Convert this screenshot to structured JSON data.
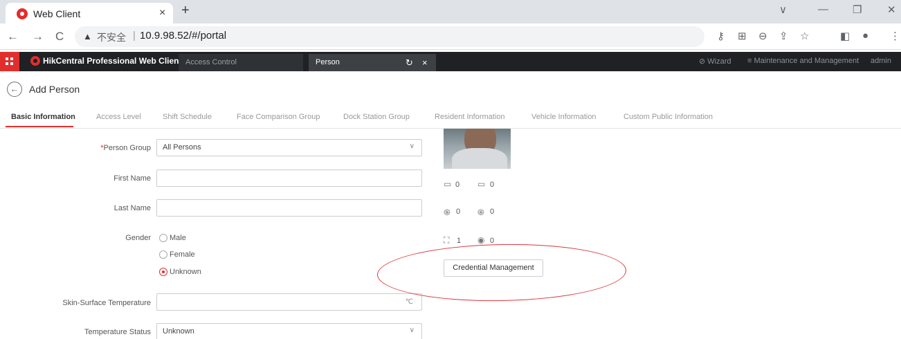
{
  "browser": {
    "tab_title": "Web Client",
    "tab_close": "×",
    "new_tab": "+",
    "window_controls": {
      "dropdown": "∨",
      "minimize": "—",
      "restore": "❐",
      "close": "✕"
    },
    "nav": {
      "back": "←",
      "forward": "→",
      "reload": "C"
    },
    "address": {
      "insecure_label": "不安全",
      "separator": "|",
      "url": "10.9.98.52/#/portal"
    },
    "toolbar_icons": {
      "key": "⚷",
      "translate": "⊞",
      "zoom": "⊖",
      "share": "⇪",
      "bookmark": "☆",
      "sidebar": "◧",
      "profile": "●",
      "menu": "⋮"
    }
  },
  "app_header": {
    "brand": "HikCentral Professional Web Client",
    "tabs": [
      "Access Control",
      "Person"
    ],
    "refresh_icon": "↻",
    "close_icon": "×",
    "wizard": "⊘ Wizard",
    "maintenance": "≡ Maintenance and Management",
    "user": "admin"
  },
  "page": {
    "back_icon": "←",
    "title": "Add Person",
    "tabs": [
      "Basic Information",
      "Access Level",
      "Shift Schedule",
      "Face Comparison Group",
      "Dock Station Group",
      "Resident Information",
      "Vehicle Information",
      "Custom Public Information"
    ],
    "active_tab": "Basic Information"
  },
  "form": {
    "person_group": {
      "required_mark": "*",
      "label": "Person Group",
      "value": "All Persons",
      "caret": "∨"
    },
    "first_name": {
      "label": "First Name",
      "value": ""
    },
    "last_name": {
      "label": "Last Name",
      "value": ""
    },
    "gender": {
      "label": "Gender",
      "options": [
        "Male",
        "Female",
        "Unknown"
      ],
      "selected": "Unknown"
    },
    "skin_temperature": {
      "label": "Skin-Surface Temperature",
      "value": "",
      "unit": "℃"
    },
    "temperature_status": {
      "label": "Temperature Status",
      "value": "Unknown",
      "caret": "∨"
    }
  },
  "credentials": {
    "counts": {
      "card": "0",
      "card_reader": "0",
      "fingerprint": "0",
      "fingerprint_reader": "0",
      "face": "1",
      "iris": "0"
    },
    "icons": {
      "card": "▭",
      "card_reader": "▭",
      "fingerprint": "֍",
      "fingerprint_reader": "֍",
      "face": "⛶",
      "iris": "◉"
    },
    "button_label": "Credential Management"
  },
  "colors": {
    "accent": "#e22d2d",
    "header_bg": "#1f2124",
    "annotation": "#d9363e"
  }
}
